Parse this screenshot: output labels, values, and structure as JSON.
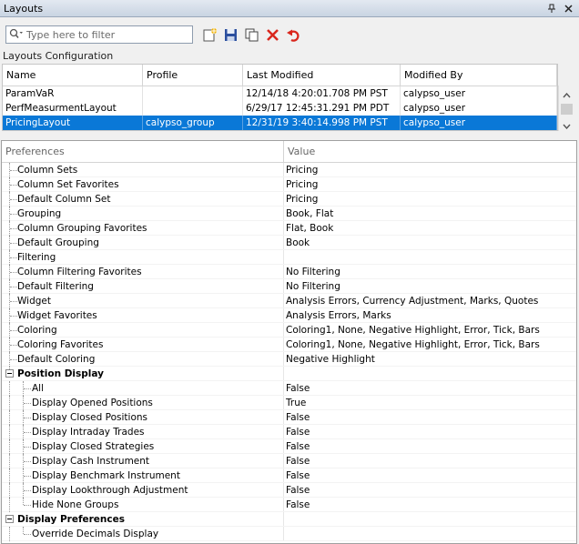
{
  "window": {
    "title": "Layouts"
  },
  "toolbar": {
    "filter_placeholder": "Type here to filter",
    "icons": [
      "search-icon",
      "new-layout-icon",
      "save-icon",
      "copy-icon",
      "delete-icon",
      "undo-icon"
    ]
  },
  "layouts_section_label": "Layouts Configuration",
  "layouts_table": {
    "columns": [
      "Name",
      "Profile",
      "Last Modified",
      "Modified By"
    ],
    "rows": [
      {
        "name": "ParamVaR",
        "profile": "",
        "last_modified": "12/14/18 4:20:01.708 PM PST",
        "modified_by": "calypso_user",
        "selected": false
      },
      {
        "name": "PerfMeasurmentLayout",
        "profile": "",
        "last_modified": "6/29/17 12:45:31.291 PM PDT",
        "modified_by": "calypso_user",
        "selected": false
      },
      {
        "name": "PricingLayout",
        "profile": "calypso_group",
        "last_modified": "12/31/19 3:40:14.998 PM PST",
        "modified_by": "calypso_user",
        "selected": true
      }
    ]
  },
  "preferences": {
    "columns": [
      "Preferences",
      "Value"
    ],
    "rows": [
      {
        "label": "Column Sets",
        "value": "Pricing"
      },
      {
        "label": "Column Set Favorites",
        "value": "Pricing"
      },
      {
        "label": "Default Column Set",
        "value": "Pricing"
      },
      {
        "label": "Grouping",
        "value": "Book, Flat"
      },
      {
        "label": "Column Grouping Favorites",
        "value": "Flat, Book"
      },
      {
        "label": "Default Grouping",
        "value": "Book"
      },
      {
        "label": "Filtering",
        "value": ""
      },
      {
        "label": "Column Filtering Favorites",
        "value": "No Filtering"
      },
      {
        "label": "Default Filtering",
        "value": "No Filtering"
      },
      {
        "label": "Widget",
        "value": "Analysis Errors, Currency Adjustment, Marks, Quotes"
      },
      {
        "label": "Widget Favorites",
        "value": "Analysis Errors, Marks"
      },
      {
        "label": "Coloring",
        "value": "Coloring1, None, Negative Highlight, Error, Tick, Bars"
      },
      {
        "label": "Coloring Favorites",
        "value": "Coloring1, None, Negative Highlight, Error, Tick, Bars"
      },
      {
        "label": "Default Coloring",
        "value": "Negative Highlight"
      },
      {
        "label": "Position Display",
        "value": ""
      },
      {
        "label": "All",
        "value": "False"
      },
      {
        "label": "Display Opened Positions",
        "value": "True"
      },
      {
        "label": "Display Closed Positions",
        "value": "False"
      },
      {
        "label": "Display Intraday Trades",
        "value": "False"
      },
      {
        "label": "Display Closed Strategies",
        "value": "False"
      },
      {
        "label": "Display Cash Instrument",
        "value": "False"
      },
      {
        "label": "Display Benchmark Instrument",
        "value": "False"
      },
      {
        "label": "Display Lookthrough Adjustment",
        "value": "False"
      },
      {
        "label": "Hide None Groups",
        "value": "False"
      },
      {
        "label": "Display Preferences",
        "value": ""
      },
      {
        "label": "Override Decimals Display",
        "value": ""
      }
    ]
  },
  "colors": {
    "selection": "#0a78d7",
    "delete": "#d9261c",
    "undo": "#d9261c"
  }
}
